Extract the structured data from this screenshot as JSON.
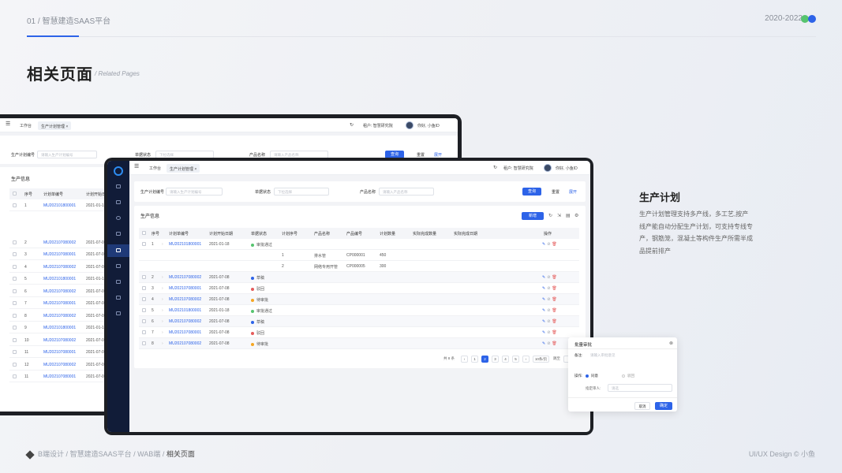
{
  "header": {
    "index": "01",
    "title": "智慧建造SAAS平台",
    "year": "2020-2022"
  },
  "page": {
    "title": "相关页面",
    "subtitle": "/ Related Pages"
  },
  "side": {
    "title": "生产计划",
    "desc": "生产计划管理支持多产线，多工艺,按产线产能自动分配生产计划，可支持专线专产，钢筋笼，混凝土等构件生产所需半成品提前排产"
  },
  "footer": {
    "c1": "B端设计",
    "c2": "智慧建造SAAS平台",
    "c3": "WAB端",
    "c4": "相关页面",
    "sep": "/",
    "copyright": "UI/UX Design © 小鱼"
  },
  "app": {
    "tab_home": "工作台",
    "tab_plan": "生产计划管理 ×",
    "user_tenant": "租户: 智慧研究院",
    "user_greet": "你好, 小鱼ID",
    "f_code": "生产计划编号",
    "ph_code": "请输入生产计划编号",
    "f_status": "单据状态",
    "ph_status": "下拉选择",
    "f_product": "产品名称",
    "ph_product": "请输入产品名称",
    "btn_query": "查询",
    "btn_reset": "重置",
    "btn_expand": "展开",
    "section": "生产信息",
    "btn_new": "新增",
    "cols": [
      "序号",
      "计划单编号",
      "计划开始日期",
      "单据状态",
      "计划序号",
      "产品名称",
      "产品编号",
      "计划数量",
      "实际完成数量",
      "实际完成日期",
      "操作"
    ],
    "rows": [
      {
        "no": "1",
        "code": "MU202101800001",
        "date": "2021-01-18",
        "status": "审批通过",
        "color": "#56c46f"
      },
      {
        "no": "2",
        "code": "MU202107080002",
        "date": "2021-07-08",
        "status": "草稿",
        "color": "#2d63e8"
      },
      {
        "no": "3",
        "code": "MU202107080001",
        "date": "2021-07-08",
        "status": "驳回",
        "color": "#e55b5b"
      },
      {
        "no": "4",
        "code": "MU202107080002",
        "date": "2021-07-08",
        "status": "待审批",
        "color": "#f5a623"
      },
      {
        "no": "5",
        "code": "MU202101800001",
        "date": "2021-01-18",
        "status": "审批通过",
        "color": "#56c46f"
      },
      {
        "no": "6",
        "code": "MU202107080002",
        "date": "2021-07-08",
        "status": "草稿",
        "color": "#2d63e8"
      },
      {
        "no": "7",
        "code": "MU202107080001",
        "date": "2021-07-08",
        "status": "驳回",
        "color": "#e55b5b"
      },
      {
        "no": "8",
        "code": "MU202107080002",
        "date": "2021-07-08",
        "status": "待审批",
        "color": "#f5a623"
      }
    ],
    "subrows": [
      {
        "seq": "1",
        "name": "排水管",
        "pcode": "CP000001",
        "qty": "450"
      },
      {
        "seq": "2",
        "name": "网络专用开管",
        "pcode": "CP000005",
        "qty": "300"
      }
    ],
    "back_rows": [
      {
        "no": "1",
        "code": "MU202101800001",
        "date": "2021-01-18"
      },
      {
        "no": "2",
        "code": "MU202107080002",
        "date": "2021-07-08"
      },
      {
        "no": "3",
        "code": "MU202107080001",
        "date": "2021-07-08"
      },
      {
        "no": "4",
        "code": "MU202107080002",
        "date": "2021-07-08"
      },
      {
        "no": "5",
        "code": "MU202101800001",
        "date": "2021-01-18"
      },
      {
        "no": "6",
        "code": "MU202107080002",
        "date": "2021-07-08"
      },
      {
        "no": "7",
        "code": "MU202107080001",
        "date": "2021-07-08"
      },
      {
        "no": "8",
        "code": "MU202107080002",
        "date": "2021-07-08"
      },
      {
        "no": "9",
        "code": "MU202101800001",
        "date": "2021-01-18"
      },
      {
        "no": "10",
        "code": "MU202107080002",
        "date": "2021-07-08"
      },
      {
        "no": "11",
        "code": "MU202107080001",
        "date": "2021-07-08"
      },
      {
        "no": "12",
        "code": "MU202107080002",
        "date": "2021-07-08"
      },
      {
        "no": "11",
        "code": "MU202107080001",
        "date": "2021-07-08"
      }
    ],
    "total": "共 8 条",
    "pages": [
      "1",
      "2",
      "3",
      "4",
      "5"
    ],
    "current_page": "2",
    "per_page": "10条/页",
    "jump": "跳至"
  },
  "dialog": {
    "title": "批量审批",
    "remark": "备注:",
    "remark_ph": "请输入审批意见",
    "op": "操作:",
    "opt_pass": "同意",
    "opt_reject": "驳回",
    "next": "指定审人:",
    "next_ph": "请选",
    "cancel": "取消",
    "ok": "确定"
  }
}
